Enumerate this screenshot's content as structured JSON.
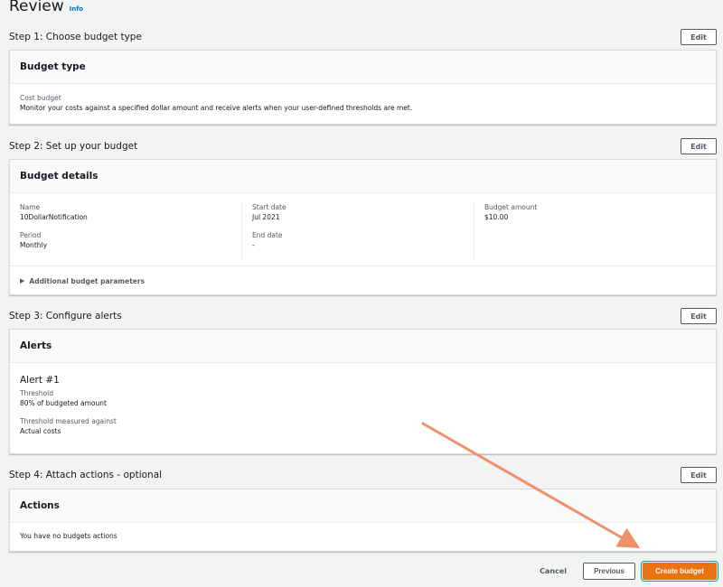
{
  "header": {
    "title": "Review",
    "info": "Info"
  },
  "step1": {
    "title": "Step 1: Choose budget type",
    "edit": "Edit",
    "card_title": "Budget type",
    "type_label": "Cost budget",
    "type_desc": "Monitor your costs against a specified dollar amount and receive alerts when your user-defined thresholds are met."
  },
  "step2": {
    "title": "Step 2: Set up your budget",
    "edit": "Edit",
    "card_title": "Budget details",
    "name_label": "Name",
    "name_value": "10DollarNotification",
    "period_label": "Period",
    "period_value": "Monthly",
    "start_label": "Start date",
    "start_value": "Jul 2021",
    "end_label": "End date",
    "end_value": "-",
    "amount_label": "Budget amount",
    "amount_value": "$10.00",
    "additional": "Additional budget parameters"
  },
  "step3": {
    "title": "Step 3: Configure alerts",
    "edit": "Edit",
    "card_title": "Alerts",
    "alert_title": "Alert #1",
    "threshold_label": "Threshold",
    "threshold_value": "80% of budgeted amount",
    "measured_label": "Threshold measured against",
    "measured_value": "Actual costs"
  },
  "step4": {
    "title": "Step 4: Attach actions - optional",
    "edit": "Edit",
    "card_title": "Actions",
    "empty": "You have no budgets actions"
  },
  "footer": {
    "cancel": "Cancel",
    "previous": "Previous",
    "create": "Create budget"
  },
  "colors": {
    "primary": "#ec7211",
    "link": "#0073bb",
    "annotation_arrow": "#f0906a"
  }
}
